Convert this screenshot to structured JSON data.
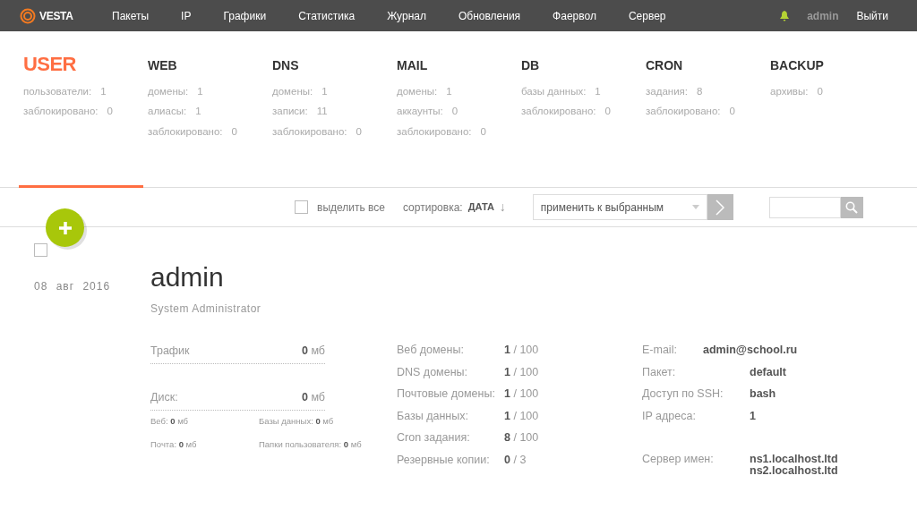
{
  "topbar": {
    "logo": "VESTA",
    "menu": [
      {
        "label": "Пакеты",
        "selected": false
      },
      {
        "label": "IP",
        "selected": false
      },
      {
        "label": "Графики",
        "selected": false
      },
      {
        "label": "Статистика",
        "selected": false
      },
      {
        "label": "Журнал",
        "selected": false
      },
      {
        "label": "Обновления",
        "selected": false
      },
      {
        "label": "Фаервол",
        "selected": false
      },
      {
        "label": "Сервер",
        "selected": false
      }
    ],
    "user": "admin",
    "logout": "Выйти"
  },
  "sections": [
    {
      "title": "USER",
      "selected": true,
      "stats": [
        {
          "label": "пользователи:",
          "value": "1"
        },
        {
          "label": "заблокировано:",
          "value": "0"
        }
      ]
    },
    {
      "title": "WEB",
      "selected": false,
      "stats": [
        {
          "label": "домены:",
          "value": "1"
        },
        {
          "label": "алиасы:",
          "value": "1"
        },
        {
          "label": "заблокировано:",
          "value": "0"
        }
      ]
    },
    {
      "title": "DNS",
      "selected": false,
      "stats": [
        {
          "label": "домены:",
          "value": "1"
        },
        {
          "label": "записи:",
          "value": "11"
        },
        {
          "label": "заблокировано:",
          "value": "0"
        }
      ]
    },
    {
      "title": "MAIL",
      "selected": false,
      "stats": [
        {
          "label": "домены:",
          "value": "1"
        },
        {
          "label": "аккаунты:",
          "value": "0"
        },
        {
          "label": "заблокировано:",
          "value": "0"
        }
      ]
    },
    {
      "title": "DB",
      "selected": false,
      "stats": [
        {
          "label": "базы данных:",
          "value": "1"
        },
        {
          "label": "заблокировано:",
          "value": "0"
        }
      ]
    },
    {
      "title": "CRON",
      "selected": false,
      "stats": [
        {
          "label": "задания:",
          "value": "8"
        },
        {
          "label": "заблокировано:",
          "value": "0"
        }
      ]
    },
    {
      "title": "BACKUP",
      "selected": false,
      "stats": [
        {
          "label": "архивы:",
          "value": "0"
        }
      ]
    }
  ],
  "toolbar": {
    "select_all": {
      "label": "выделить все",
      "checked": false
    },
    "sort": {
      "label": "сортировка:",
      "value": "ДАТА",
      "arrow": "↓"
    },
    "apply": {
      "label": "применить к выбранным"
    }
  },
  "record": {
    "checked": false,
    "date": "08 авг 2016",
    "name": "admin",
    "role": "System Administrator",
    "traffic": {
      "label": "Трафик",
      "value": "0",
      "unit": "мб"
    },
    "disk": {
      "label": "Диск:",
      "value": "0",
      "unit": "мб"
    },
    "disk_parts": [
      {
        "label": "Веб:",
        "value": "0",
        "unit": "мб"
      },
      {
        "label": "Базы данных:",
        "value": "0",
        "unit": "мб"
      },
      {
        "label": "Почта:",
        "value": "0",
        "unit": "мб"
      },
      {
        "label": "Папки пользователя:",
        "value": "0",
        "unit": "мб"
      }
    ],
    "limits": [
      {
        "label": "Веб домены:",
        "used": "1",
        "limit": "/ 100"
      },
      {
        "label": "DNS домены:",
        "used": "1",
        "limit": "/ 100"
      },
      {
        "label": "Почтовые домены:",
        "used": "1",
        "limit": "/ 100"
      },
      {
        "label": "Базы данных:",
        "used": "1",
        "limit": "/ 100"
      },
      {
        "label": "Cron задания:",
        "used": "8",
        "limit": "/ 100"
      },
      {
        "label": "Резервные копии:",
        "used": "0",
        "limit": "/ 3"
      }
    ],
    "info": [
      {
        "kind": "inline",
        "label": "E-mail:",
        "values": [
          "admin@school.ru"
        ]
      },
      {
        "kind": "row",
        "label": "Пакет:",
        "values": [
          "default"
        ]
      },
      {
        "kind": "row",
        "label": "Доступ по SSH:",
        "values": [
          "bash"
        ]
      },
      {
        "kind": "row",
        "label": "IP адреса:",
        "values": [
          "1"
        ]
      },
      {
        "kind": "gap",
        "label": "Сервер имен:",
        "values": [
          "ns1.localhost.ltd",
          "ns2.localhost.ltd"
        ]
      }
    ]
  }
}
